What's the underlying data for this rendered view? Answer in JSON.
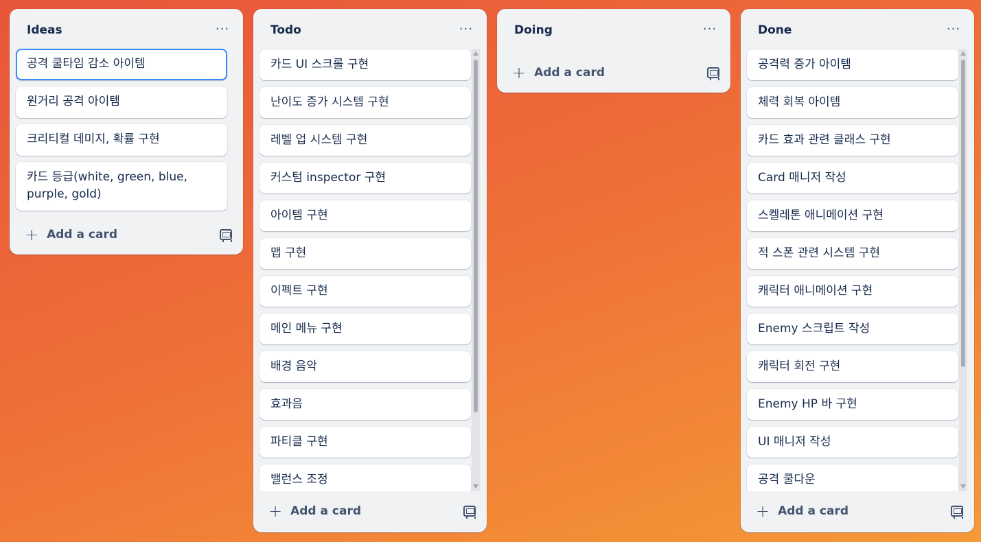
{
  "board": {
    "lists": [
      {
        "title": "Ideas",
        "menu": "···",
        "cards": [
          "공격 쿨타임 감소 아이템",
          "원거리 공격 아이템",
          "크리티컬 데미지, 확률 구현",
          "카드 등급(white, green, blue, purple, gold)"
        ],
        "add_label": "Add a card"
      },
      {
        "title": "Todo",
        "menu": "···",
        "cards": [
          "카드 UI 스크롤 구현",
          "난이도 증가 시스템 구현",
          "레벨 업 시스템 구현",
          "커스텀 inspector 구현",
          "아이템 구현",
          "맵 구현",
          "이펙트 구현",
          "메인 메뉴 구현",
          "배경 음악",
          "효과음",
          "파티클 구현",
          "밸런스 조정"
        ],
        "add_label": "Add a card"
      },
      {
        "title": "Doing",
        "menu": "···",
        "cards": [],
        "add_label": "Add a card"
      },
      {
        "title": "Done",
        "menu": "···",
        "cards": [
          "공격력 증가 아이템",
          "체력 회복 아이템",
          "카드 효과 관련 클래스 구현",
          "Card 매니저 작성",
          "스켈레톤 애니메이션 구현",
          "적 스폰 관련 시스템 구현",
          "캐릭터 애니메이션 구현",
          "Enemy 스크립트 작성",
          "캐릭터 회전 구현",
          "Enemy HP 바 구현",
          "UI 매니저 작성",
          "공격 쿨다운"
        ],
        "add_label": "Add a card"
      }
    ]
  },
  "colors": {
    "background_start": "#e8553a",
    "background_end": "#f59a38",
    "list_bg": "#f1f2f4",
    "card_bg": "#ffffff",
    "selected_outline": "#388bff"
  },
  "icons": {
    "menu": "more-icon",
    "add": "plus-icon",
    "template": "card-template-icon"
  }
}
